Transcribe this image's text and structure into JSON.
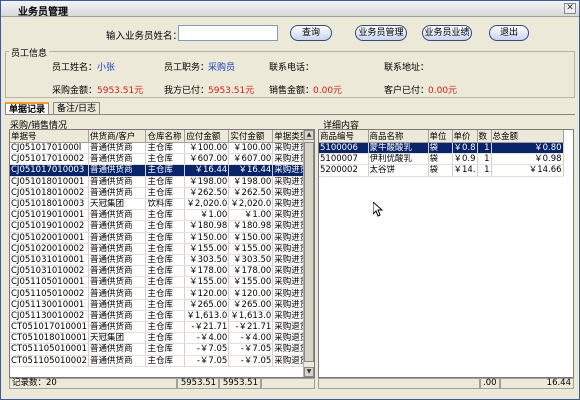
{
  "window": {
    "title": "业务员管理"
  },
  "toolbar": {
    "search_label": "输入业务员姓名：",
    "search_value": "",
    "btn_query": "查询",
    "btn_manage": "业务员管理",
    "btn_performance": "业务员业绩",
    "btn_exit": "退出"
  },
  "employee": {
    "group_title": "员工信息",
    "name_label": "员工姓名：",
    "name_value": "小张",
    "position_label": "员工职务：",
    "position_value": "采购员",
    "phone_label": "联系电话：",
    "phone_value": "",
    "address_label": "联系地址：",
    "address_value": "",
    "purchase_label": "采购金额：",
    "purchase_value": "5953.51元",
    "paid_label": "我方已付：",
    "paid_value": "5953.51元",
    "sales_label": "销售金额：",
    "sales_value": "0.00元",
    "received_label": "客户已付：",
    "received_value": "0.00元"
  },
  "tabs": [
    {
      "label": "单据记录"
    },
    {
      "label": "备注/日志"
    }
  ],
  "left_panel": {
    "title": "采购/销售情况",
    "columns": [
      "单据号",
      "供货商/客户",
      "仓库名称",
      "应付金额",
      "实付金额",
      "单据类型"
    ],
    "rows": [
      [
        "CJ05101701000l",
        "普通供货商",
        "主仓库",
        "￥100.00",
        "￥100.00",
        "采购进货"
      ],
      [
        "CJ051017010002",
        "普通供货商",
        "主仓库",
        "￥607.00",
        "￥607.00",
        "采购进货"
      ],
      [
        "CJ051017010003",
        "普通供货商",
        "主仓库",
        "￥16.44",
        "￥16.44",
        "采购进货"
      ],
      [
        "CJ051018010001",
        "普通供货商",
        "主仓库",
        "￥198.00",
        "￥198.00",
        "采购进货"
      ],
      [
        "CJ051018010002",
        "普通供货商",
        "主仓库",
        "￥262.50",
        "￥262.50",
        "采购进货"
      ],
      [
        "CJ051018010003",
        "天冠集团",
        "饮料库",
        "￥2,020.0",
        "￥2,020.0",
        "采购进货"
      ],
      [
        "CJ051019010001",
        "普通供货商",
        "主仓库",
        "￥1.00",
        "￥1.00",
        "采购进货"
      ],
      [
        "CJ051019010002",
        "普通供货商",
        "主仓库",
        "￥180.98",
        "￥180.98",
        "采购进货"
      ],
      [
        "CJ051020010001",
        "普通供货商",
        "主仓库",
        "￥150.00",
        "￥150.00",
        "采购进货"
      ],
      [
        "CJ051020010002",
        "普通供货商",
        "主仓库",
        "￥155.00",
        "￥155.00",
        "采购进货"
      ],
      [
        "CJ051031010001",
        "普通供货商",
        "主仓库",
        "￥303.50",
        "￥303.50",
        "采购进货"
      ],
      [
        "CJ051031010002",
        "普通供货商",
        "主仓库",
        "￥178.00",
        "￥178.00",
        "采购进货"
      ],
      [
        "CJ051105010001",
        "普通供货商",
        "主仓库",
        "￥155.00",
        "￥155.00",
        "采购进货"
      ],
      [
        "CJ051105010002",
        "普通供货商",
        "主仓库",
        "￥120.00",
        "￥120.00",
        "采购进货"
      ],
      [
        "CJ051130010001",
        "普通供货商",
        "主仓库",
        "￥265.00",
        "￥265.00",
        "采购进货"
      ],
      [
        "CJ051130010002",
        "普通供货商",
        "主仓库",
        "￥1,613.0",
        "￥1,613.0",
        "采购进货"
      ],
      [
        "CT051017010001",
        "普通供货商",
        "主仓库",
        "-￥21.71",
        "-￥21.71",
        "采购退货"
      ],
      [
        "CT051018010001",
        "天冠集团",
        "主仓库",
        "-￥4.00",
        "-￥4.00",
        "采购退货"
      ],
      [
        "CT051105010001",
        "普通供货商",
        "主仓库",
        "-￥7.05",
        "-￥7.05",
        "采购退货"
      ],
      [
        "CT051105010002",
        "普通供货商",
        "主仓库",
        "-￥7.05",
        "-￥7.05",
        "采购退货"
      ]
    ],
    "selected_row": 2,
    "footer_count": "记录数：20",
    "footer_due": "5953.51",
    "footer_paid": "5953.51"
  },
  "right_panel": {
    "title": "详细内容",
    "columns": [
      "商品编号",
      "商品名称",
      "单位",
      "单价",
      "数",
      "总金额"
    ],
    "rows": [
      [
        "5100006",
        "蒙牛酸酸乳",
        "袋",
        "￥0.8",
        "1",
        "￥0.80"
      ],
      [
        "5100007",
        "伊利优酸乳",
        "袋",
        "￥0.9",
        "1",
        "￥0.98"
      ],
      [
        "5200002",
        "太谷饼",
        "袋",
        "￥14.",
        "1",
        "￥14.66"
      ]
    ],
    "selected_row": 0,
    "footer_left": ".00",
    "footer_total": "16.44"
  }
}
